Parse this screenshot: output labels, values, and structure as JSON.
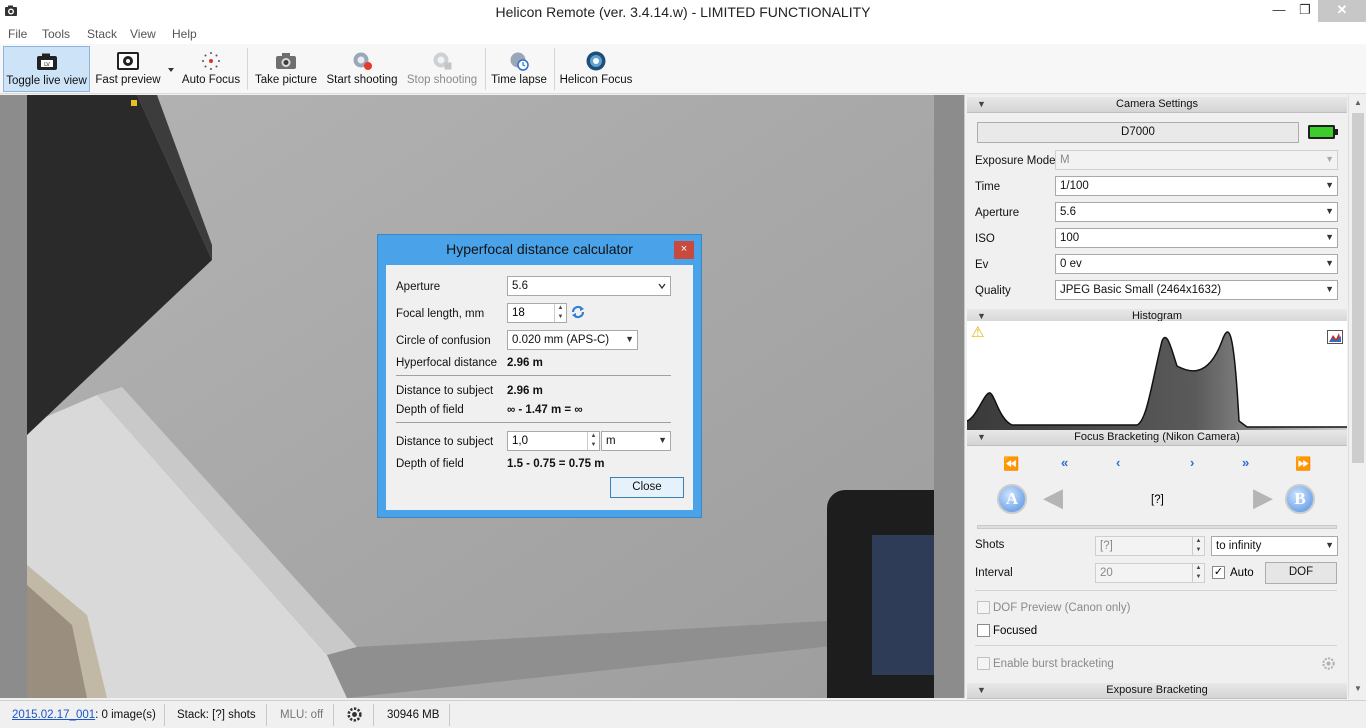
{
  "window": {
    "title": "Helicon Remote (ver. 3.4.14.w) - LIMITED FUNCTIONALITY",
    "minimize_glyph": "—",
    "maximize_glyph": "❐",
    "close_glyph": "✕"
  },
  "menu": {
    "items": [
      "File",
      "Tools",
      "Stack",
      "View",
      "Help"
    ]
  },
  "toolbar": {
    "toggle_live_view": "Toggle live view",
    "fast_preview": "Fast preview",
    "auto_focus": "Auto Focus",
    "take_picture": "Take picture",
    "start_shooting": "Start shooting",
    "stop_shooting": "Stop shooting",
    "time_lapse": "Time lapse",
    "helicon_focus": "Helicon Focus"
  },
  "dialog": {
    "title": "Hyperfocal distance calculator",
    "close_glyph": "×",
    "aperture_label": "Aperture",
    "aperture_value": "5.6",
    "focal_length_label": "Focal length, mm",
    "focal_length_value": "18",
    "coc_label": "Circle of confusion",
    "coc_value": "0.020 mm (APS-C)",
    "hyperfocal_label": "Hyperfocal distance",
    "hyperfocal_value": "2.96 m",
    "distance1_label": "Distance to subject",
    "distance1_value": "2.96 m",
    "dof1_label": "Depth of field",
    "dof1_value": "∞ - 1.47 m = ∞",
    "distance2_label": "Distance to subject",
    "distance2_value": "1,0",
    "distance2_unit": "m",
    "dof2_label": "Depth of field",
    "dof2_value": "1.5 - 0.75 = 0.75 m",
    "close_button": "Close"
  },
  "camera_settings": {
    "header": "Camera Settings",
    "camera_name": "D7000",
    "battery_level": 1.0,
    "rows": [
      {
        "label": "Exposure Mode",
        "value": "M"
      },
      {
        "label": "Time",
        "value": "1/100"
      },
      {
        "label": "Aperture",
        "value": "5.6"
      },
      {
        "label": "ISO",
        "value": "100"
      },
      {
        "label": "Ev",
        "value": "0 ev"
      },
      {
        "label": "Quality",
        "value": "JPEG Basic Small (2464x1632)"
      }
    ]
  },
  "histogram": {
    "header": "Histogram",
    "warning_glyph": "⚠"
  },
  "focus_bracketing": {
    "header": "Focus Bracketing (Nikon Camera)",
    "nav_glyphs": [
      "⏪",
      "«",
      "‹",
      "›",
      "»",
      "⏩"
    ],
    "a_label": "A",
    "b_label": "B",
    "position_text": "[?]",
    "shots_label": "Shots",
    "shots_value": "[?]",
    "shots_mode": "to infinity",
    "interval_label": "Interval",
    "interval_value": "20",
    "auto_label": "Auto",
    "auto_checked": true,
    "dof_button": "DOF",
    "dof_preview_label": "DOF Preview (Canon only)",
    "focused_label": "Focused",
    "burst_label": "Enable burst bracketing"
  },
  "exposure_bracketing": {
    "header": "Exposure Bracketing"
  },
  "status": {
    "stack_link": "2015.02.17_001",
    "images": ": 0 image(s)",
    "stack": "Stack: [?] shots",
    "mlu": "MLU: off",
    "disk": "30946 MB"
  }
}
